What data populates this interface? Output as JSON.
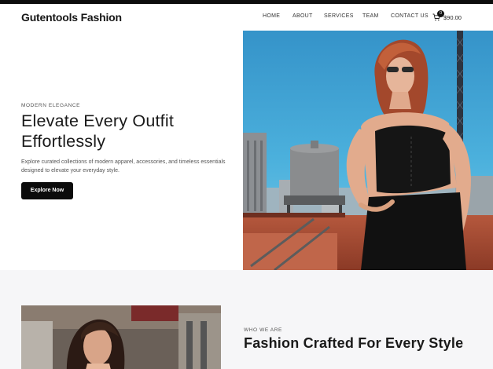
{
  "site": {
    "logo": "Gutentools Fashion"
  },
  "nav": {
    "items": [
      {
        "label": "HOME"
      },
      {
        "label": "ABOUT"
      },
      {
        "label": "SERVICES"
      },
      {
        "label": "TEAM"
      },
      {
        "label": "CONTACT US"
      }
    ]
  },
  "cart": {
    "count": "0",
    "total": "$90.00",
    "icon": "cart-icon"
  },
  "hero": {
    "eyebrow": "MODERN ELEGANCE",
    "title": "Elevate Every Outfit Effortlessly",
    "description": "Explore curated collections of modern apparel, accessories, and timeless essentials designed to elevate your everyday style.",
    "cta": "Explore Now"
  },
  "about": {
    "eyebrow": "WHO WE ARE",
    "title": "Fashion Crafted For Every Style"
  },
  "colors": {
    "topbar": "#0d0d0d",
    "button": "#0b0b0b",
    "section_bg": "#f6f6f8",
    "sky": "#3fa6d8"
  }
}
